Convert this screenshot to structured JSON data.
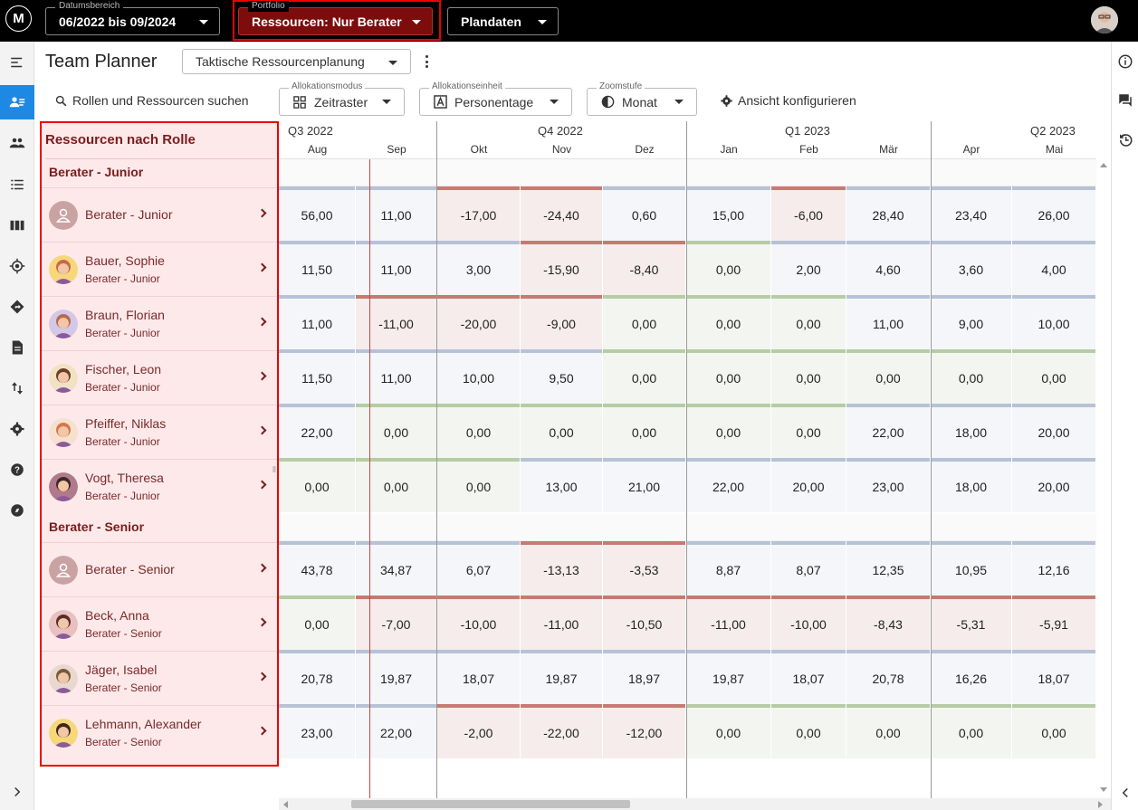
{
  "topbar": {
    "logo_text": "M",
    "date_range": {
      "label": "Datumsbereich",
      "value": "06/2022 bis 09/2024"
    },
    "portfolio": {
      "label": "Portfolio",
      "value": "Ressourcen: Nur Berater"
    },
    "plan": {
      "value": "Plandaten"
    }
  },
  "page": {
    "title": "Team Planner",
    "view_select": "Taktische Ressourcenplanung"
  },
  "toolbar": {
    "search_label": "Rollen und Ressourcen suchen",
    "alloc_mode": {
      "label": "Allokationsmodus",
      "value": "Zeitraster"
    },
    "alloc_unit": {
      "label": "Allokationseinheit",
      "value": "Personentage"
    },
    "zoom": {
      "label": "Zoomstufe",
      "value": "Monat"
    },
    "configure_label": "Ansicht konfigurieren"
  },
  "resources_panel": {
    "title": "Ressourcen nach Rolle",
    "groups": [
      {
        "name": "Berater - Junior"
      },
      {
        "name": "Berater - Senior"
      }
    ],
    "rows": [
      {
        "name": "Berater - Junior",
        "role": ""
      },
      {
        "name": "Bauer, Sophie",
        "role": "Berater - Junior"
      },
      {
        "name": "Braun, Florian",
        "role": "Berater - Junior"
      },
      {
        "name": "Fischer, Leon",
        "role": "Berater - Junior"
      },
      {
        "name": "Pfeiffer, Niklas",
        "role": "Berater - Junior"
      },
      {
        "name": "Vogt, Theresa",
        "role": "Berater - Junior"
      },
      {
        "name": "Berater - Senior",
        "role": ""
      },
      {
        "name": "Beck, Anna",
        "role": "Berater - Senior"
      },
      {
        "name": "Jäger, Isabel",
        "role": "Berater - Senior"
      },
      {
        "name": "Lehmann, Alexander",
        "role": "Berater - Senior"
      }
    ]
  },
  "timeline": {
    "quarters": [
      "Q3 2022",
      "Q4 2022",
      "Q1 2023",
      "Q2 2023"
    ],
    "months": [
      "Aug",
      "Sep",
      "Okt",
      "Nov",
      "Dez",
      "Jan",
      "Feb",
      "Mär",
      "Apr",
      "Mai"
    ]
  },
  "grid_values": [
    [
      "56,00",
      "11,00",
      "-17,00",
      "-24,40",
      "0,60",
      "15,00",
      "-6,00",
      "28,40",
      "23,40",
      "26,00"
    ],
    [
      "11,50",
      "11,00",
      "3,00",
      "-15,90",
      "-8,40",
      "0,00",
      "2,00",
      "4,60",
      "3,60",
      "4,00"
    ],
    [
      "11,00",
      "-11,00",
      "-20,00",
      "-9,00",
      "0,00",
      "0,00",
      "0,00",
      "11,00",
      "9,00",
      "10,00"
    ],
    [
      "11,50",
      "11,00",
      "10,00",
      "9,50",
      "0,00",
      "0,00",
      "0,00",
      "0,00",
      "0,00",
      "0,00"
    ],
    [
      "22,00",
      "0,00",
      "0,00",
      "0,00",
      "0,00",
      "0,00",
      "0,00",
      "22,00",
      "18,00",
      "20,00"
    ],
    [
      "0,00",
      "0,00",
      "0,00",
      "13,00",
      "21,00",
      "22,00",
      "20,00",
      "23,00",
      "18,00",
      "20,00"
    ],
    [
      "43,78",
      "34,87",
      "6,07",
      "-13,13",
      "-3,53",
      "8,87",
      "8,07",
      "12,35",
      "10,95",
      "12,16"
    ],
    [
      "0,00",
      "-7,00",
      "-10,00",
      "-11,00",
      "-10,50",
      "-11,00",
      "-10,00",
      "-8,43",
      "-5,31",
      "-5,91"
    ],
    [
      "20,78",
      "19,87",
      "18,07",
      "19,87",
      "18,97",
      "19,87",
      "18,07",
      "20,78",
      "16,26",
      "18,07"
    ],
    [
      "23,00",
      "22,00",
      "-2,00",
      "-22,00",
      "-12,00",
      "0,00",
      "0,00",
      "0,00",
      "0,00",
      "0,00"
    ]
  ],
  "colors": {
    "accent": "#1e88e5",
    "portfolio_bg": "#7d0c0c",
    "highlight_border": "#ee0000",
    "panel_bg": "#fde9ea",
    "positive_bar": "#b6c2d6",
    "negative_bar": "#c57b72",
    "zero_bar": "#b5cca4"
  }
}
